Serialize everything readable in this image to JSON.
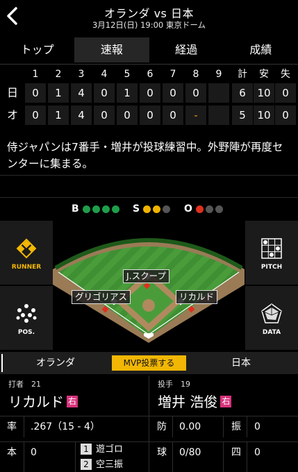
{
  "header": {
    "title": "オランダ vs 日本",
    "subtitle": "3月12日(日) 19:00 東京ドーム"
  },
  "tabs": [
    {
      "label": "トップ",
      "active": false
    },
    {
      "label": "速報",
      "active": true
    },
    {
      "label": "経過",
      "active": false
    },
    {
      "label": "成績",
      "active": false
    }
  ],
  "scoreboard": {
    "innings": [
      "1",
      "2",
      "3",
      "4",
      "5",
      "6",
      "7",
      "8",
      "9"
    ],
    "total_headers": [
      "計",
      "安",
      "失"
    ],
    "rows": [
      {
        "team": "日",
        "scores": [
          "0",
          "1",
          "4",
          "0",
          "1",
          "0",
          "0",
          "0",
          ""
        ],
        "totals": [
          "6",
          "10",
          "0"
        ]
      },
      {
        "team": "オ",
        "scores": [
          "0",
          "1",
          "4",
          "0",
          "0",
          "0",
          "0",
          "-",
          ""
        ],
        "totals": [
          "5",
          "10",
          "0"
        ]
      }
    ]
  },
  "comment": "侍ジャパンは7番手・増井が投球練習中。外野陣が再度センターに集まる。",
  "count": {
    "ball_label": "B",
    "balls": 0,
    "ball_max": 4,
    "ball_color": "#1f9e4a",
    "strike_label": "S",
    "strikes": 0,
    "strike_max": 3,
    "strike_color": "#f0b400",
    "out_label": "O",
    "outs": 1,
    "out_max": 3,
    "out_color": "#e0301e",
    "off_color": "#555555"
  },
  "side_buttons": {
    "runner": "RUNNER",
    "pitch": "PITCH",
    "pos": "POS.",
    "data": "DATA"
  },
  "field_labels": {
    "center": "J.スクープ",
    "shortstop": "グリゴリアス",
    "second": "リカルド"
  },
  "team_bar": {
    "left": "オランダ",
    "mvp": "MVP投票する",
    "right": "日本"
  },
  "batter": {
    "role": "打者　21",
    "name": "リカルド",
    "hand": "右"
  },
  "pitcher": {
    "role": "投手　19",
    "name": "増井 浩俊",
    "hand": "右"
  },
  "batter_stats": {
    "avg_label": "率",
    "avg_value": ".267（15 - 4）",
    "hr_label": "本",
    "hr_value": "0",
    "plays": [
      {
        "num": "1",
        "text": "遊ゴロ"
      },
      {
        "num": "2",
        "text": "空三振"
      }
    ]
  },
  "pitcher_stats": {
    "era_label": "防",
    "era_value": "0.00",
    "k_label": "振",
    "k_value": "0",
    "pitch_label": "球",
    "pitch_value": "0/80",
    "bb_label": "四",
    "bb_value": "0"
  }
}
